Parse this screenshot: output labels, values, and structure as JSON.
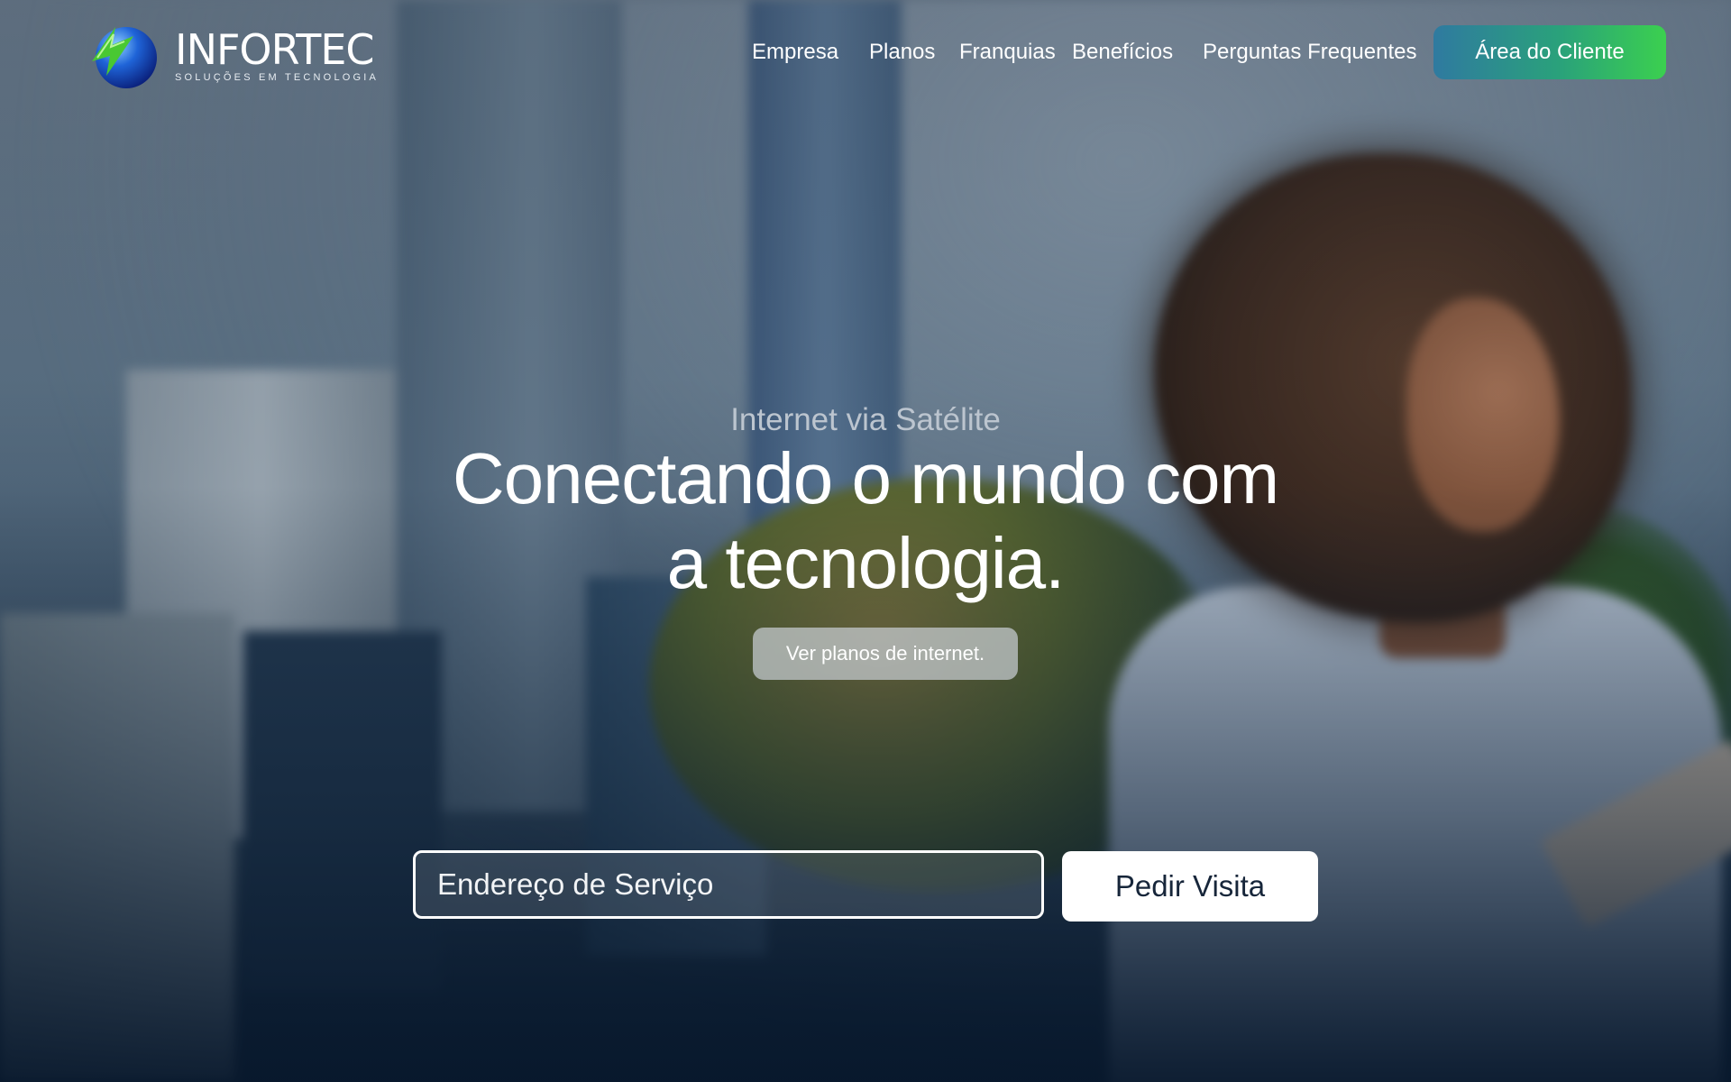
{
  "brand": {
    "name": "INFORTEC",
    "tagline": "SOLUÇÕES EM TECNOLOGIA",
    "logo_icon": "globe-icon"
  },
  "nav": {
    "items": [
      "Empresa",
      "Planos",
      "Franquias",
      "Benefícios",
      "Perguntas Frequentes"
    ],
    "client_area_label": "Área do Cliente"
  },
  "hero": {
    "subtitle": "Internet via Satélite",
    "headline_line1": "Conectando o mundo com",
    "headline_line2": "a tecnologia.",
    "plans_button": "Ver planos de internet."
  },
  "service_form": {
    "address_placeholder": "Endereço de Serviço",
    "address_value": "",
    "submit_label": "Pedir Visita"
  },
  "colors": {
    "cta_gradient_start": "#2f7aa0",
    "cta_gradient_end": "#3bd04f",
    "bottom_overlay": "#0e2238"
  }
}
